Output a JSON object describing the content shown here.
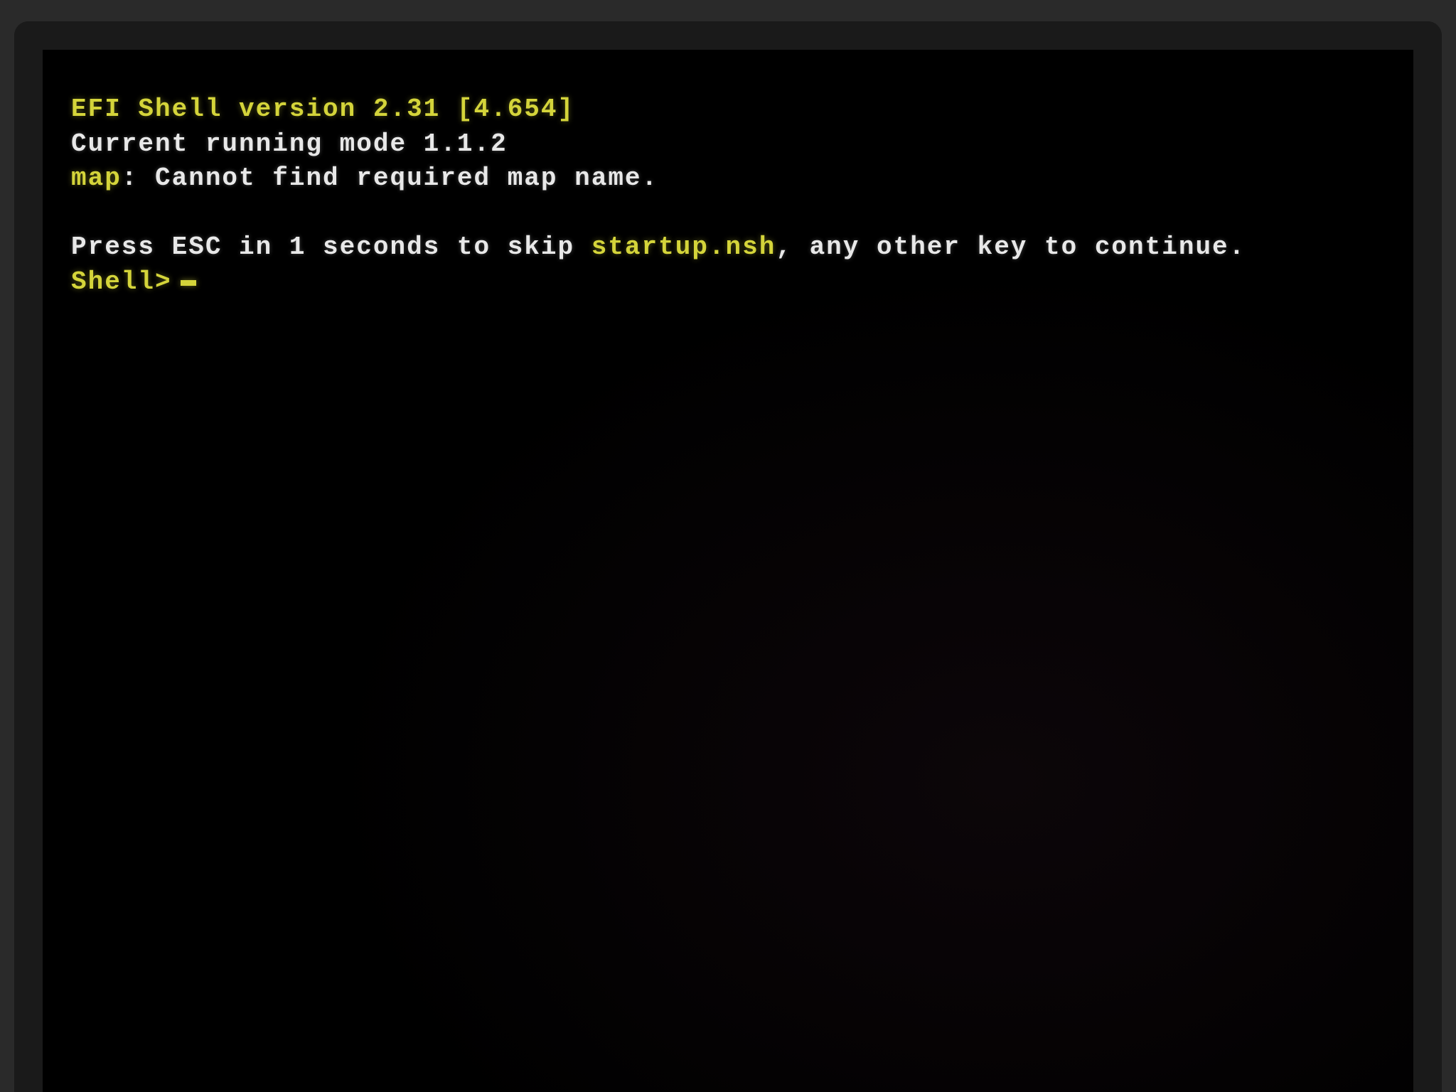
{
  "shell": {
    "header": "EFI Shell version 2.31 [4.654]",
    "mode_line": "Current running mode 1.1.2",
    "map_prefix": "map",
    "map_error": ": Cannot find required map name.",
    "press_prefix": "Press ",
    "esc_key": "ESC",
    "press_mid": " in 1 seconds to skip ",
    "startup_file": "startup.nsh",
    "press_suffix": ", any other key to continue.",
    "prompt": "Shell> "
  }
}
